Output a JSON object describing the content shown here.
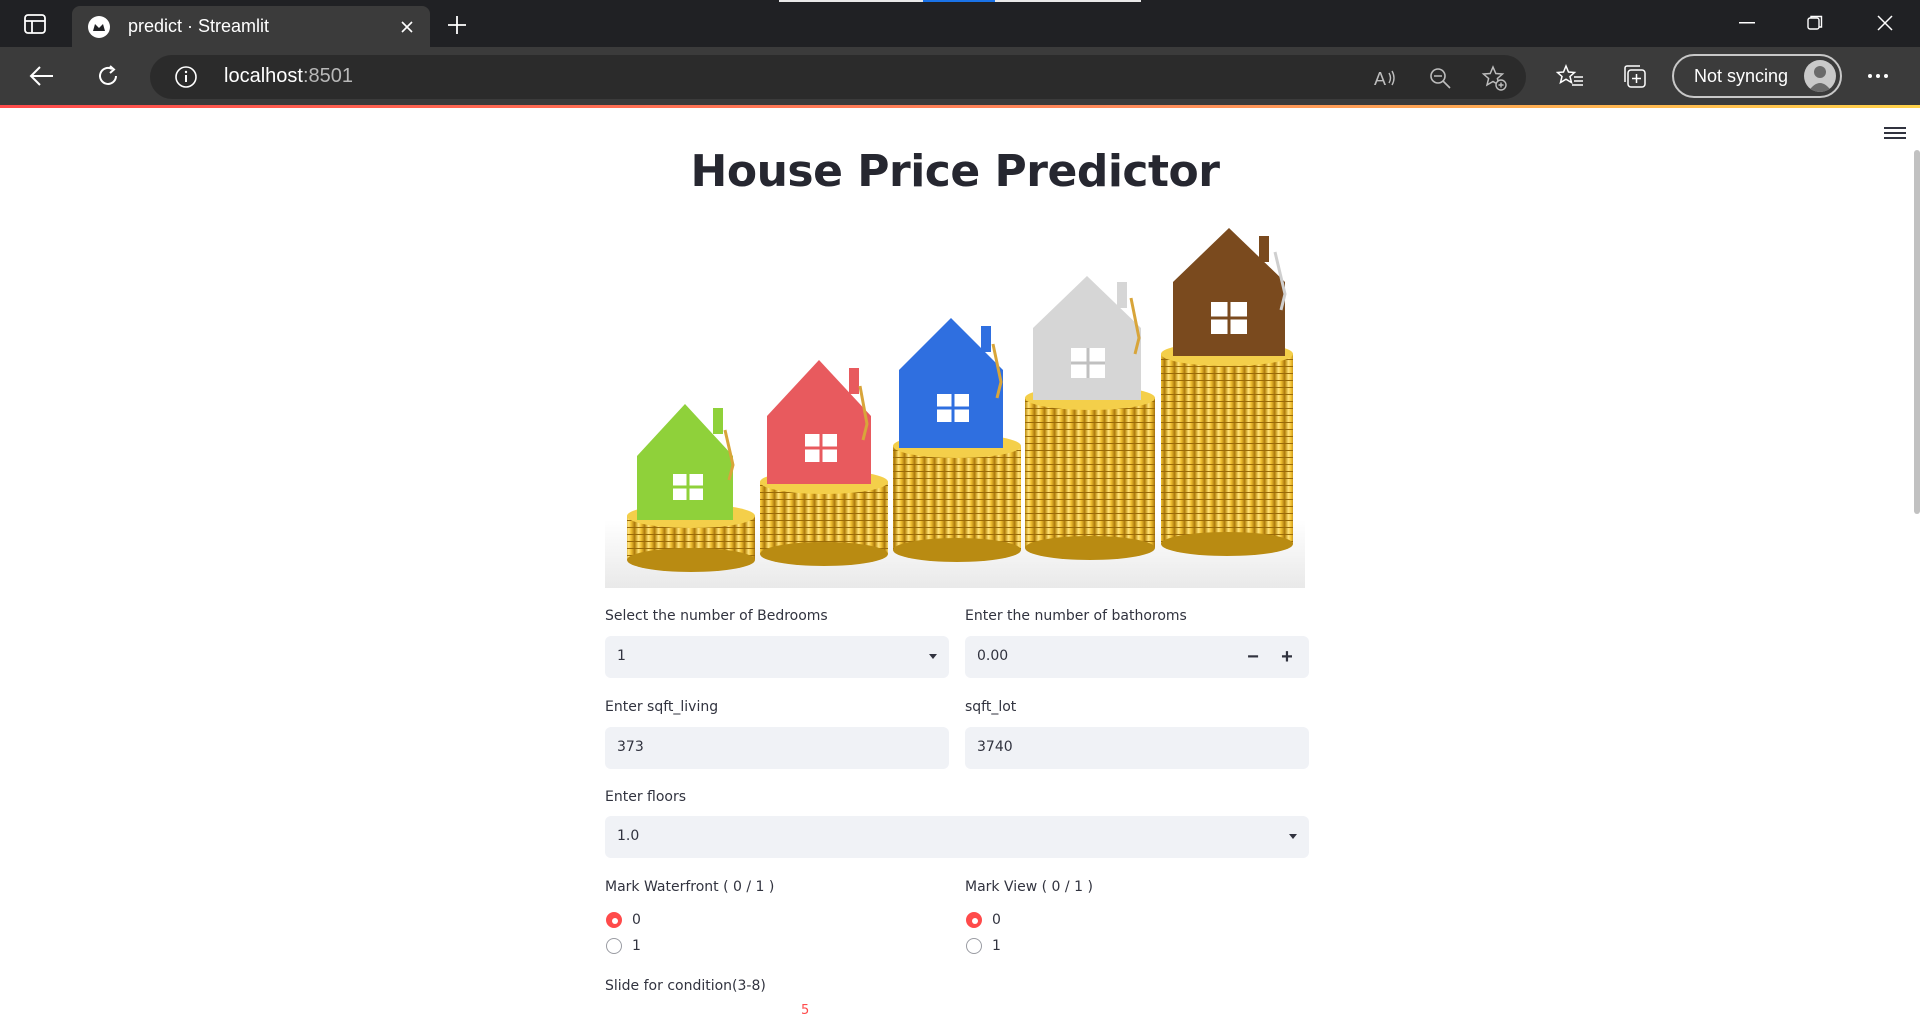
{
  "browser": {
    "tab_title": "predict · Streamlit",
    "url_host": "localhost",
    "url_port": ":8501",
    "sync_label": "Not syncing",
    "icons": [
      "tab-actions-icon",
      "streamlit-favicon-icon",
      "close-icon",
      "plus-icon",
      "minimize-icon",
      "restore-icon",
      "close-window-icon",
      "back-icon",
      "refresh-icon",
      "info-icon",
      "read-aloud-icon",
      "zoom-out-icon",
      "add-favorite-icon",
      "favorites-icon",
      "collections-icon",
      "profile-icon",
      "more-icon"
    ]
  },
  "app": {
    "title": "House Price Predictor",
    "hero_image": "houses-on-coin-stacks-image",
    "bedrooms": {
      "label": "Select the number of Bedrooms",
      "value": "1"
    },
    "bathrooms": {
      "label": "Enter the number of bathoroms",
      "value": "0.00",
      "minus": "−",
      "plus": "+"
    },
    "sqft_living": {
      "label": "Enter sqft_living",
      "value": "373"
    },
    "sqft_lot": {
      "label": "sqft_lot",
      "value": "3740"
    },
    "floors": {
      "label": "Enter floors",
      "value": "1.0"
    },
    "waterfront": {
      "label": "Mark Waterfront ( 0 / 1 )",
      "options": [
        "0",
        "1"
      ],
      "selected": "0"
    },
    "view": {
      "label": "Mark View ( 0 / 1 )",
      "options": [
        "0",
        "1"
      ],
      "selected": "0"
    },
    "condition": {
      "label": "Slide for condition(3-8)",
      "value": "5"
    }
  },
  "colors": {
    "accent": "#ff4b4b",
    "input_bg": "#f0f2f6",
    "chrome_dark": "#202124",
    "chrome_toolbar": "#3b3b3b"
  }
}
